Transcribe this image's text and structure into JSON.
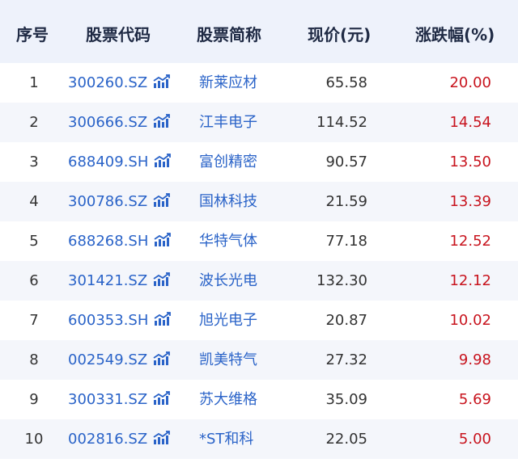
{
  "columns": {
    "index": "序号",
    "code": "股票代码",
    "name": "股票简称",
    "price": "现价(元)",
    "change": "涨跌幅(%)"
  },
  "icons": {
    "trend": "trend-chart-icon"
  },
  "colors": {
    "link": "#2a63c8",
    "up": "#c8141e",
    "header_bg": "#eef2fb",
    "stripe_bg": "#f4f6fb"
  },
  "rows": [
    {
      "index": "1",
      "code": "300260.SZ",
      "name": "新莱应材",
      "price": "65.58",
      "change": "20.00"
    },
    {
      "index": "2",
      "code": "300666.SZ",
      "name": "江丰电子",
      "price": "114.52",
      "change": "14.54"
    },
    {
      "index": "3",
      "code": "688409.SH",
      "name": "富创精密",
      "price": "90.57",
      "change": "13.50"
    },
    {
      "index": "4",
      "code": "300786.SZ",
      "name": "国林科技",
      "price": "21.59",
      "change": "13.39"
    },
    {
      "index": "5",
      "code": "688268.SH",
      "name": "华特气体",
      "price": "77.18",
      "change": "12.52"
    },
    {
      "index": "6",
      "code": "301421.SZ",
      "name": "波长光电",
      "price": "132.30",
      "change": "12.12"
    },
    {
      "index": "7",
      "code": "600353.SH",
      "name": "旭光电子",
      "price": "20.87",
      "change": "10.02"
    },
    {
      "index": "8",
      "code": "002549.SZ",
      "name": "凯美特气",
      "price": "27.32",
      "change": "9.98"
    },
    {
      "index": "9",
      "code": "300331.SZ",
      "name": "苏大维格",
      "price": "35.09",
      "change": "5.69"
    },
    {
      "index": "10",
      "code": "002816.SZ",
      "name": "*ST和科",
      "price": "22.05",
      "change": "5.00"
    }
  ]
}
